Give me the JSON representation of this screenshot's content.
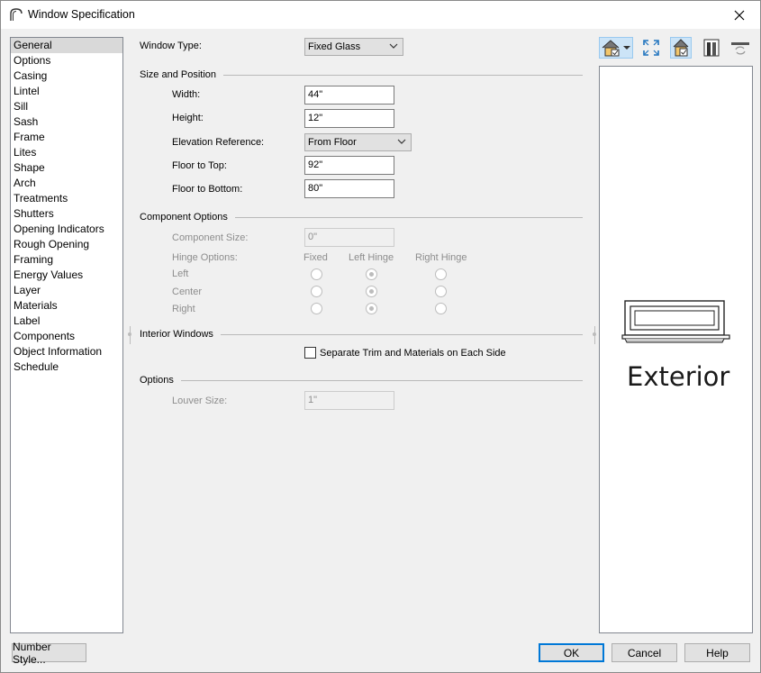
{
  "window": {
    "title": "Window Specification",
    "icons": {
      "app": "arch-window-icon",
      "close": "close-icon"
    }
  },
  "sidebar": {
    "selected_index": 0,
    "items": [
      {
        "label": "General"
      },
      {
        "label": "Options"
      },
      {
        "label": "Casing"
      },
      {
        "label": "Lintel"
      },
      {
        "label": "Sill"
      },
      {
        "label": "Sash"
      },
      {
        "label": "Frame"
      },
      {
        "label": "Lites"
      },
      {
        "label": "Shape"
      },
      {
        "label": "Arch"
      },
      {
        "label": "Treatments"
      },
      {
        "label": "Shutters"
      },
      {
        "label": "Opening Indicators"
      },
      {
        "label": "Rough Opening"
      },
      {
        "label": "Framing"
      },
      {
        "label": "Energy Values"
      },
      {
        "label": "Layer"
      },
      {
        "label": "Materials"
      },
      {
        "label": "Label"
      },
      {
        "label": "Components"
      },
      {
        "label": "Object Information"
      },
      {
        "label": "Schedule"
      }
    ]
  },
  "general": {
    "window_type": {
      "label": "Window Type:",
      "value": "Fixed Glass"
    },
    "size_position": {
      "heading": "Size and Position",
      "width": {
        "label": "Width:",
        "value": "44\""
      },
      "height": {
        "label": "Height:",
        "value": "12\""
      },
      "elevation_reference": {
        "label": "Elevation Reference:",
        "value": "From Floor"
      },
      "floor_to_top": {
        "label": "Floor to Top:",
        "value": "92\""
      },
      "floor_to_bottom": {
        "label": "Floor to Bottom:",
        "value": "80\""
      }
    },
    "component_options": {
      "heading": "Component Options",
      "component_size": {
        "label": "Component Size:",
        "value": "0\"",
        "disabled": true
      },
      "hinge_options_label": "Hinge Options:",
      "columns": [
        "Fixed",
        "Left Hinge",
        "Right Hinge"
      ],
      "rows": [
        {
          "label": "Left",
          "selected": "Left Hinge"
        },
        {
          "label": "Center",
          "selected": "Left Hinge"
        },
        {
          "label": "Right",
          "selected": "Left Hinge"
        }
      ]
    },
    "interior_windows": {
      "heading": "Interior Windows",
      "separate_trim": {
        "label": "Separate Trim and Materials on Each Side",
        "checked": false
      }
    },
    "options": {
      "heading": "Options",
      "louver_size": {
        "label": "Louver Size:",
        "value": "1\"",
        "disabled": true
      }
    }
  },
  "preview": {
    "label": "Exterior",
    "toolbar": [
      {
        "name": "elevation-view-icon",
        "active": true,
        "has_dropdown": true
      },
      {
        "name": "fit-to-window-icon",
        "active": false
      },
      {
        "name": "show-house-icon",
        "active": true
      },
      {
        "name": "door-view-icon",
        "active": false
      },
      {
        "name": "refresh-icon",
        "active": false
      }
    ]
  },
  "footer": {
    "number_style": "Number Style...",
    "ok": "OK",
    "cancel": "Cancel",
    "help": "Help"
  }
}
